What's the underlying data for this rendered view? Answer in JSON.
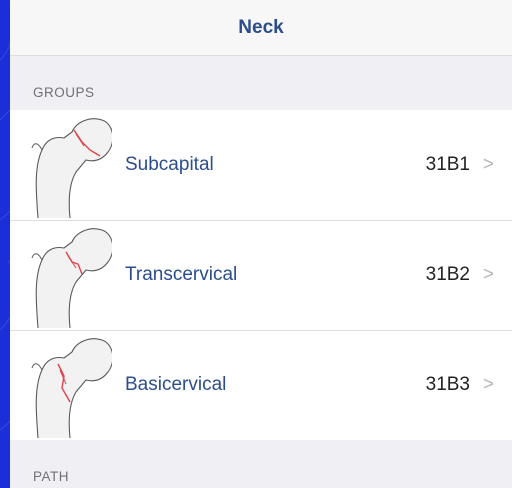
{
  "navbar": {
    "title": "Neck"
  },
  "groups": {
    "header": "GROUPS",
    "items": [
      {
        "label": "Subcapital",
        "code": "31B1",
        "chevron": ">"
      },
      {
        "label": "Transcervical",
        "code": "31B2",
        "chevron": ">"
      },
      {
        "label": "Basicervical",
        "code": "31B3",
        "chevron": ">"
      }
    ]
  },
  "path": {
    "header": "PATH"
  },
  "colors": {
    "background": "#1a2fd8",
    "accent": "#2b4d8c",
    "fracture": "#e0414e",
    "chevron": "#b6b6bc"
  }
}
